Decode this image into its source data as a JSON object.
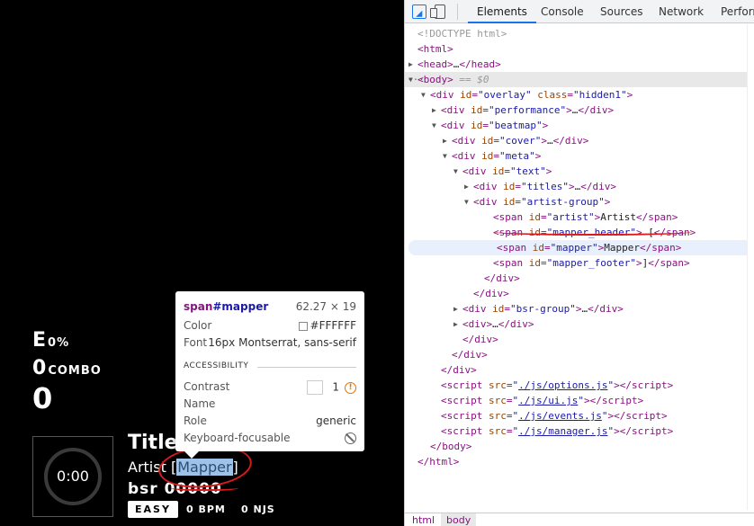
{
  "preview": {
    "performance": {
      "rank": "E",
      "accuracy": "0%",
      "combo_value": "0",
      "combo_label": "COMBO",
      "score": "0"
    },
    "cover": {
      "time": "0:00"
    },
    "title": "Title",
    "artist": "Artist",
    "mapper_header": "[",
    "mapper": "Mapper",
    "mapper_footer": "]",
    "bsr_label": "bsr",
    "bsr_value": "00000",
    "difficulty": "EASY",
    "bpm": "0 BPM",
    "njs": "0 NJS"
  },
  "tooltip": {
    "tag": "span",
    "id": "#mapper",
    "dims": "62.27 × 19",
    "color_label": "Color",
    "color_value": "#FFFFFF",
    "font_label": "Font",
    "font_value": "16px Montserrat, sans-serif",
    "section": "ACCESSIBILITY",
    "contrast_label": "Contrast",
    "contrast_value": "1",
    "name_label": "Name",
    "name_value": "",
    "role_label": "Role",
    "role_value": "generic",
    "focus_label": "Keyboard-focusable"
  },
  "devtools": {
    "tabs": [
      "Elements",
      "Console",
      "Sources",
      "Network",
      "Performance"
    ],
    "breadcrumbs": [
      "html",
      "body"
    ],
    "tree": {
      "doctype": "<!DOCTYPE html>",
      "html_open": "<html>",
      "head": "<head>…</head>",
      "body_open": "<body>",
      "body_eq": "== $0",
      "overlay": [
        "div",
        "id",
        "overlay",
        "class",
        "hidden1"
      ],
      "performance": [
        "div",
        "id",
        "performance"
      ],
      "beatmap": [
        "div",
        "id",
        "beatmap"
      ],
      "cover": [
        "div",
        "id",
        "cover"
      ],
      "meta": [
        "div",
        "id",
        "meta"
      ],
      "text": [
        "div",
        "id",
        "text"
      ],
      "titles": [
        "div",
        "id",
        "titles"
      ],
      "artist_group": [
        "div",
        "id",
        "artist-group"
      ],
      "artist_span": [
        "span",
        "id",
        "artist",
        "Artist"
      ],
      "mapper_header_span": [
        "span",
        "id",
        "mapper_header",
        " ["
      ],
      "mapper_span": [
        "span",
        "id",
        "mapper",
        "Mapper"
      ],
      "mapper_footer_span": [
        "span",
        "id",
        "mapper_footer",
        "]"
      ],
      "bsr_group": [
        "div",
        "id",
        "bsr-group"
      ],
      "scripts": [
        "./js/options.js",
        "./js/ui.js",
        "./js/events.js",
        "./js/manager.js"
      ]
    }
  }
}
